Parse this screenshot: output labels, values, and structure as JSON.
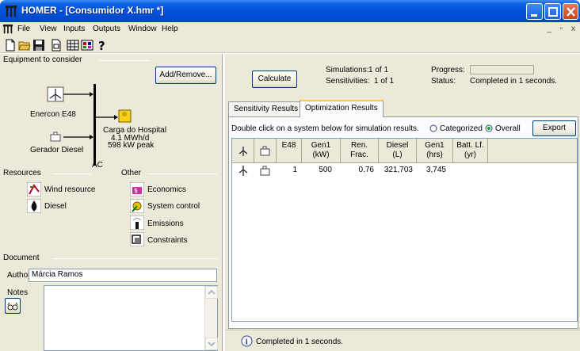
{
  "window": {
    "title": "HOMER - [Consumidor X.hmr *]"
  },
  "menu": [
    "File",
    "View",
    "Inputs",
    "Outputs",
    "Window",
    "Help"
  ],
  "toolbar_icons": [
    "new-file-icon",
    "open-folder-icon",
    "save-icon",
    "print-preview-icon",
    "grid-table-icon",
    "chart-icon",
    "help-icon"
  ],
  "equipment": {
    "header": "Equipment to consider",
    "add_remove": "Add/Remove...",
    "turbine": "Enercon E48",
    "generator": "Gerador Diesel",
    "bus": "AC",
    "load_name": "Carga do Hospital",
    "load_energy": "4.1 MWh/d",
    "load_peak": "598 kW peak"
  },
  "resources": {
    "header": "Resources",
    "items": [
      "Wind resource",
      "Diesel"
    ]
  },
  "other": {
    "header": "Other",
    "items": [
      "Economics",
      "System control",
      "Emissions",
      "Constraints"
    ]
  },
  "document": {
    "header": "Document",
    "author_label": "Author",
    "author_value": "Márcia Ramos",
    "notes_label": "Notes"
  },
  "calc": {
    "button": "Calculate",
    "simulations_label": "Simulations:",
    "simulations_value": "1 of 1",
    "sensitivities_label": "Sensitivities:",
    "sensitivities_value": "1 of 1",
    "progress_label": "Progress:",
    "status_label": "Status:",
    "status_value": "Completed in 1 seconds."
  },
  "tabs": [
    "Sensitivity Results",
    "Optimization Results"
  ],
  "results": {
    "hint": "Double click on a system below for simulation results.",
    "radio_categorized": "Categorized",
    "radio_overall": "Overall",
    "export": "Export",
    "columns": [
      {
        "l1": "",
        "l2": ""
      },
      {
        "l1": "",
        "l2": ""
      },
      {
        "l1": "E48",
        "l2": ""
      },
      {
        "l1": "Gen1",
        "l2": "(kW)"
      },
      {
        "l1": "Ren.",
        "l2": "Frac."
      },
      {
        "l1": "Diesel",
        "l2": "(L)"
      },
      {
        "l1": "Gen1",
        "l2": "(hrs)"
      },
      {
        "l1": "Batt. Lf.",
        "l2": "(yr)"
      }
    ],
    "row": {
      "e48": "1",
      "gen1_kw": "500",
      "ren_frac": "0.76",
      "diesel_l": "321,703",
      "gen1_hrs": "3,745",
      "batt_lf": ""
    }
  },
  "statusbar": {
    "text": "Completed in 1 seconds."
  }
}
